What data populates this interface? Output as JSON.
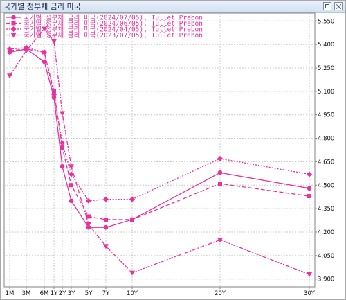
{
  "window": {
    "title": "국가별 정부채 금리 미국"
  },
  "chart_data": {
    "type": "line",
    "title": "",
    "xlabel": "",
    "ylabel": "",
    "categories": [
      "1M",
      "3M",
      "6M",
      "1Y",
      "2Y",
      "3Y",
      "5Y",
      "7Y",
      "10Y",
      "20Y",
      "30Y"
    ],
    "ylim": [
      3.85,
      5.6
    ],
    "y_ticks": [
      3.9,
      4.05,
      4.2,
      4.35,
      4.5,
      4.65,
      4.8,
      4.95,
      5.1,
      5.25,
      5.4,
      5.55
    ],
    "y_tick_labels": [
      "3,900",
      "4,050",
      "4,200",
      "4,350",
      "4,500",
      "4,650",
      "4,800",
      "4,950",
      "5,100",
      "5,250",
      "5,400",
      "5,550"
    ],
    "y_axis_side": "right",
    "grid": true,
    "legend_position": "top-left",
    "series": [
      {
        "name": "국가별 정부채 금리 미국(2024/07/05), Tullet Prebon",
        "marker": "circle",
        "dash": "solid",
        "values": [
          5.35,
          5.37,
          5.29,
          5.06,
          4.62,
          4.4,
          4.23,
          4.23,
          4.28,
          4.58,
          4.48
        ]
      },
      {
        "name": "국가별 정부채 금리 미국(2024/06/05), Tullet Prebon",
        "marker": "square",
        "dash": "dash",
        "values": [
          5.36,
          5.37,
          5.35,
          5.1,
          4.74,
          4.5,
          4.3,
          4.28,
          4.28,
          4.51,
          4.43
        ]
      },
      {
        "name": "국가별 정부채 금리 미국(2024/04/05), Tullet Prebon",
        "marker": "diamond",
        "dash": "dot",
        "values": [
          5.37,
          5.38,
          5.35,
          5.08,
          4.77,
          4.57,
          4.4,
          4.41,
          4.41,
          4.67,
          4.57
        ]
      },
      {
        "name": "국가별 정부채 금리 미국(2023/07/05), Tullet Prebon",
        "marker": "triangle-down",
        "dash": "dashdot",
        "values": [
          5.2,
          5.36,
          5.5,
          5.42,
          4.96,
          4.62,
          4.25,
          4.11,
          3.94,
          4.15,
          3.93
        ]
      }
    ],
    "line_color": "#e6319f",
    "grid_color": "#c8c8c8"
  }
}
